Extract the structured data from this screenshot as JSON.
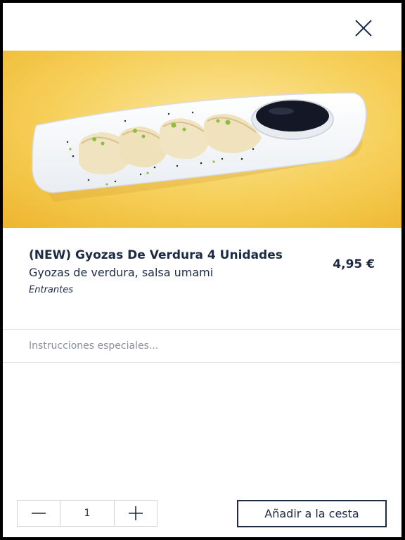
{
  "product": {
    "title": "(NEW) Gyozas De Verdura 4 Unidades",
    "price": "4,95 €",
    "description": "Gyozas de verdura, salsa umami",
    "category": "Entrantes",
    "image_icon": "gyoza-plate-image"
  },
  "instructions": {
    "placeholder": "Instrucciones especiales...",
    "value": ""
  },
  "quantity": {
    "value": "1",
    "decrement_icon": "minus-icon",
    "increment_icon": "plus-icon"
  },
  "actions": {
    "add_to_cart_label": "Añadir a la cesta",
    "close_icon": "close-icon"
  },
  "colors": {
    "text_primary": "#1d2a44",
    "border": "#cfd3da",
    "hero_background": "#f3c84a"
  }
}
